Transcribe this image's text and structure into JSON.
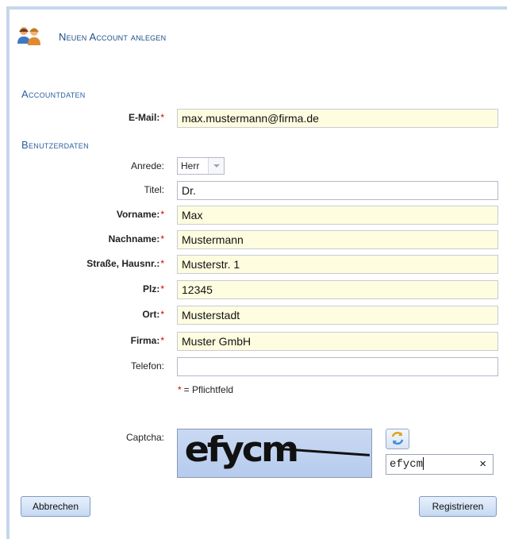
{
  "header": {
    "title": "Neuen Account anlegen"
  },
  "sections": {
    "account": "Accountdaten",
    "user": "Benutzerdaten"
  },
  "fields": {
    "email": {
      "label": "E-Mail:",
      "value": "max.mustermann@firma.de",
      "required": true
    },
    "anrede": {
      "label": "Anrede:",
      "value": "Herr"
    },
    "titel": {
      "label": "Titel:",
      "value": "Dr."
    },
    "vorname": {
      "label": "Vorname:",
      "value": "Max",
      "required": true
    },
    "nachname": {
      "label": "Nachname:",
      "value": "Mustermann",
      "required": true
    },
    "strasse": {
      "label": "Straße, Hausnr.:",
      "value": "Musterstr. 1",
      "required": true
    },
    "plz": {
      "label": "Plz:",
      "value": "12345",
      "required": true
    },
    "ort": {
      "label": "Ort:",
      "value": "Musterstadt",
      "required": true
    },
    "firma": {
      "label": "Firma:",
      "value": "Muster GmbH",
      "required": true
    },
    "telefon": {
      "label": "Telefon:",
      "value": ""
    }
  },
  "required_marker": "*",
  "required_note": "= Pflichtfeld",
  "captcha": {
    "label": "Captcha:",
    "image_text": "efycm",
    "input_value": "efycm",
    "clear_glyph": "×"
  },
  "buttons": {
    "cancel": "Abbrechen",
    "register": "Registrieren"
  },
  "colors": {
    "required_field_bg": "#fffde0",
    "section_heading": "#2a5f9e",
    "required_star": "#d40000"
  }
}
